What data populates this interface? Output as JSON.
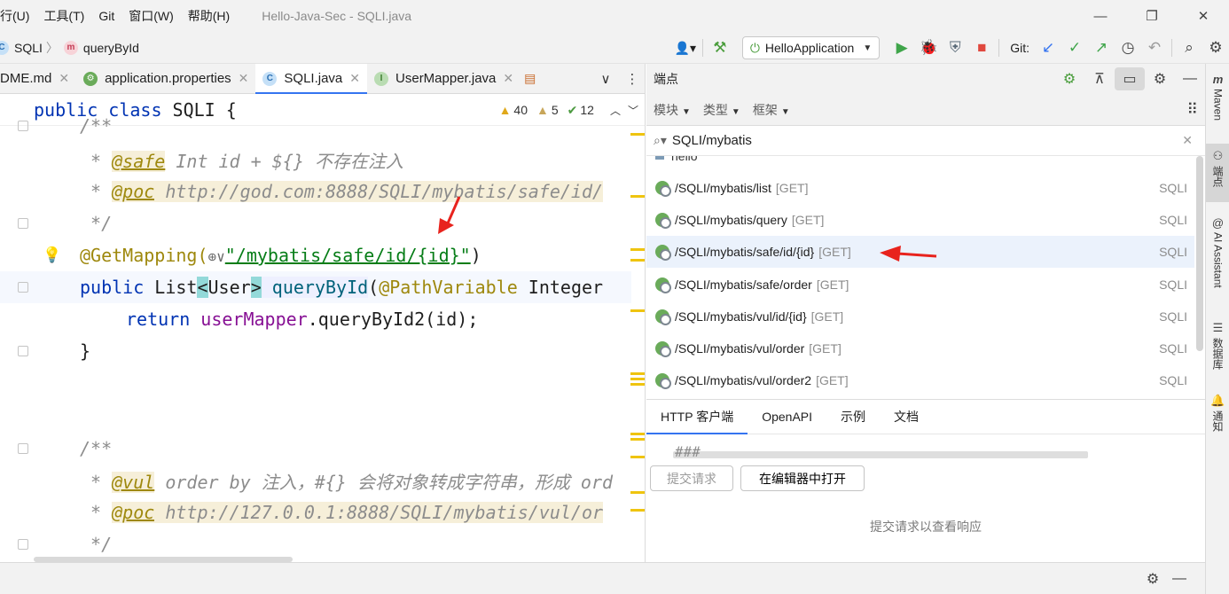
{
  "menu": {
    "items": [
      "行(U)",
      "工具(T)",
      "Git",
      "窗口(W)",
      "帮助(H)"
    ],
    "window_title": "Hello-Java-Sec - SQLI.java"
  },
  "breadcrumb": {
    "class_name": "SQLI",
    "method_name": "queryById"
  },
  "toolbar": {
    "run_config": "HelloApplication",
    "git_label": "Git:"
  },
  "editor": {
    "tabs": [
      {
        "label": "DME.md",
        "icon": "markdown",
        "active": false
      },
      {
        "label": "application.properties",
        "icon": "spring-properties-icon",
        "active": false
      },
      {
        "label": "SQLI.java",
        "icon": "class-icon",
        "active": true
      },
      {
        "label": "UserMapper.java",
        "icon": "interface-icon",
        "active": false
      }
    ],
    "sticky_line": {
      "keyword": "public class",
      "name": "SQLI",
      "brace": "{"
    },
    "inspections": {
      "warnings": "40",
      "weak_warnings": "5",
      "typos": "12"
    },
    "lines": {
      "l1": "/**",
      "l2_star": " * ",
      "l2_tag": "@safe",
      "l2_text": " Int id + ${} 不存在注入",
      "l3_star": " * ",
      "l3_tag": "@poc",
      "l3_url": " http://god.com:8888/SQLI/mybatis/safe/id/",
      "l4": " */",
      "l5_ann": "@GetMapping(",
      "l5_icon": "⊕∨",
      "l5_str": "\"/mybatis/safe/id/{id}\"",
      "l5_close": ")",
      "l6_kw": "public",
      "l6_type": " List",
      "l6_lt": "<",
      "l6_user": "User",
      "l6_gt": ">",
      "l6_method": " queryById",
      "l6_rest": "(",
      "l6_pv": "@PathVariable",
      "l6_integer": " Integer",
      "l7_kw": "return",
      "l7_field": " userMapper",
      "l7_call": ".queryById2(id);",
      "l8": "}",
      "l11": "/**",
      "l12_star": " * ",
      "l12_tag": "@vul",
      "l12_text": " order by 注入，#{} 会将对象转成字符串，形成 ord",
      "l13_star": " * ",
      "l13_tag": "@poc",
      "l13_url": " http://127.0.0.1:8888/SQLI/mybatis/vul/or",
      "l14": " */"
    }
  },
  "endpoints": {
    "title": "端点",
    "filters": [
      "模块",
      "类型",
      "框架"
    ],
    "search_value": "SQLI/mybatis",
    "partial_row": "hello",
    "rows": [
      {
        "path": "/SQLI/mybatis/list",
        "method": "[GET]",
        "module": "SQLI",
        "selected": false
      },
      {
        "path": "/SQLI/mybatis/query",
        "method": "[GET]",
        "module": "SQLI",
        "selected": false
      },
      {
        "path": "/SQLI/mybatis/safe/id/{id}",
        "method": "[GET]",
        "module": "SQLI",
        "selected": true
      },
      {
        "path": "/SQLI/mybatis/safe/order",
        "method": "[GET]",
        "module": "SQLI",
        "selected": false
      },
      {
        "path": "/SQLI/mybatis/vul/id/{id}",
        "method": "[GET]",
        "module": "SQLI",
        "selected": false
      },
      {
        "path": "/SQLI/mybatis/vul/order",
        "method": "[GET]",
        "module": "SQLI",
        "selected": false
      },
      {
        "path": "/SQLI/mybatis/vul/order2",
        "method": "[GET]",
        "module": "SQLI",
        "selected": false
      }
    ],
    "http_tabs": [
      "HTTP 客户端",
      "OpenAPI",
      "示例",
      "文档"
    ],
    "http_hash": "###",
    "submit_button": "提交请求",
    "open_editor_button": "在编辑器中打开",
    "empty_message": "提交请求以查看响应"
  },
  "right_strip": {
    "maven": "Maven",
    "endpoints": "端点",
    "ai": "AI Assistant",
    "database": "数据库",
    "notifications": "通知"
  },
  "colors": {
    "accent": "#3574f0",
    "annotation_arrow": "#e8231d",
    "selected_row": "#ebf2fc",
    "keyword": "#0033b3",
    "string": "#067d17"
  }
}
